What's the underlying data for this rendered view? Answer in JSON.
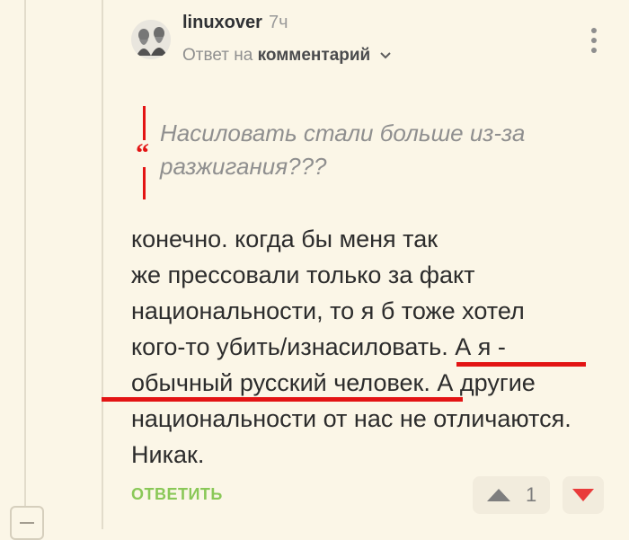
{
  "comment": {
    "username": "linuxover",
    "time": "7ч",
    "reply_prefix": "Ответ на",
    "reply_target": "комментарий",
    "quote": "Насиловать стали больше из-за разжигания???",
    "body_lines": [
      "конечно. когда бы меня так",
      "же прессовали только за факт",
      "национальности, то я б тоже хотел",
      "кого-то убить/изнасиловать. А я -",
      "обычный русский человек. А другие",
      "национальности от нас не отличаются.",
      "Никак."
    ],
    "reply_button": "ОТВЕТИТЬ",
    "rating": "1"
  },
  "colors": {
    "accent_red": "#e31414",
    "reply_green": "#8ac858",
    "background": "#fbf6e7"
  },
  "icons": {
    "more": "vertical-dots-icon",
    "expand": "chevron-down-icon",
    "quote": "quote-mark-icon",
    "upvote": "triangle-up-icon",
    "downvote": "triangle-down-icon",
    "collapse": "minus-icon"
  }
}
